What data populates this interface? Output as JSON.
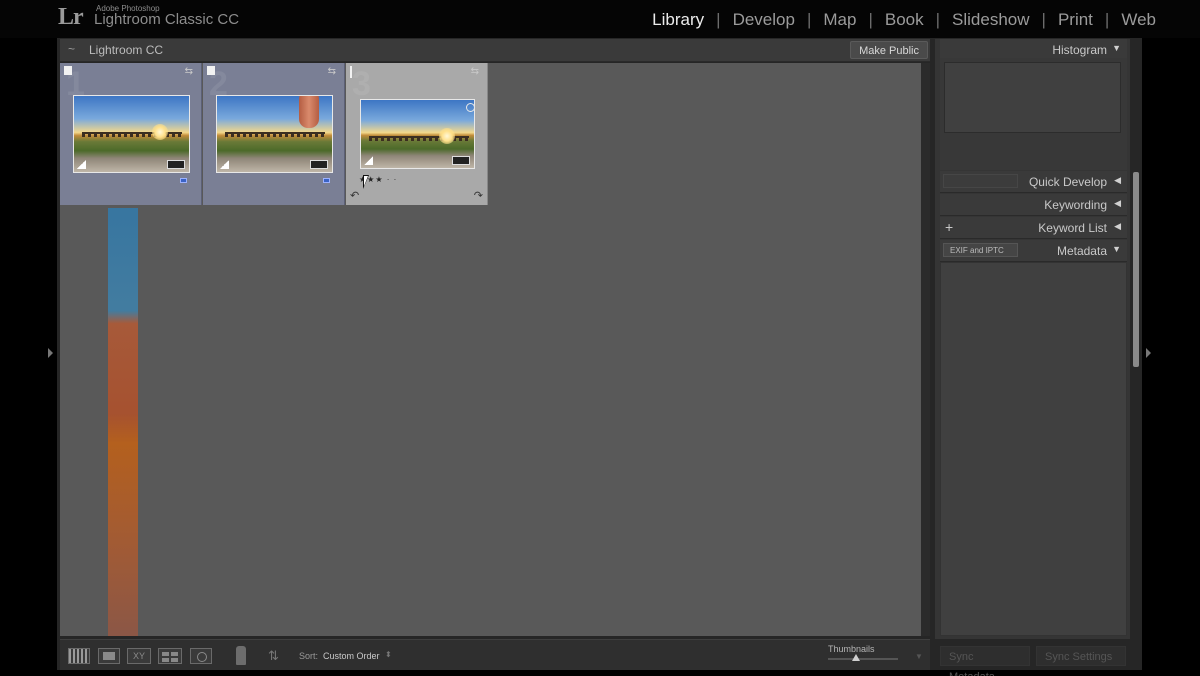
{
  "app": {
    "brand_small": "Adobe Photoshop",
    "brand_name": "Lightroom Classic CC",
    "logo_text": "Lr"
  },
  "modules": [
    {
      "label": "Library",
      "active": true
    },
    {
      "label": "Develop",
      "active": false
    },
    {
      "label": "Map",
      "active": false
    },
    {
      "label": "Book",
      "active": false
    },
    {
      "label": "Slideshow",
      "active": false
    },
    {
      "label": "Print",
      "active": false
    },
    {
      "label": "Web",
      "active": false
    }
  ],
  "collection": {
    "name": "Lightroom CC",
    "make_public_label": "Make Public"
  },
  "grid": {
    "cells": [
      {
        "index": "1",
        "selected": false,
        "rating_stars": 0
      },
      {
        "index": "2",
        "selected": false,
        "rating_stars": 0
      },
      {
        "index": "3",
        "selected": true,
        "rating_stars": 3
      }
    ],
    "stars_text": "★★★ · ·"
  },
  "toolbar": {
    "compare_label": "XY",
    "sort_label": "Sort:",
    "sort_value": "Custom Order",
    "thumbnails_label": "Thumbnails",
    "thumbnail_size": 0.4
  },
  "right_panel": {
    "histogram_title": "Histogram",
    "quick_develop_title": "Quick Develop",
    "quick_develop_preset": "",
    "keywording_title": "Keywording",
    "keyword_list_title": "Keyword List",
    "metadata_title": "Metadata",
    "metadata_preset": "EXIF and IPTC",
    "sync_metadata_label": "Sync Metadata",
    "sync_settings_label": "Sync Settings",
    "arrow_expanded": "▼",
    "arrow_collapsed": "◀",
    "plus": "+"
  },
  "colors": {
    "grid_background": "#595959",
    "selected_cell": "#a9a9a9",
    "cell_background": "#7a7f95",
    "module_active": "#ececec"
  }
}
